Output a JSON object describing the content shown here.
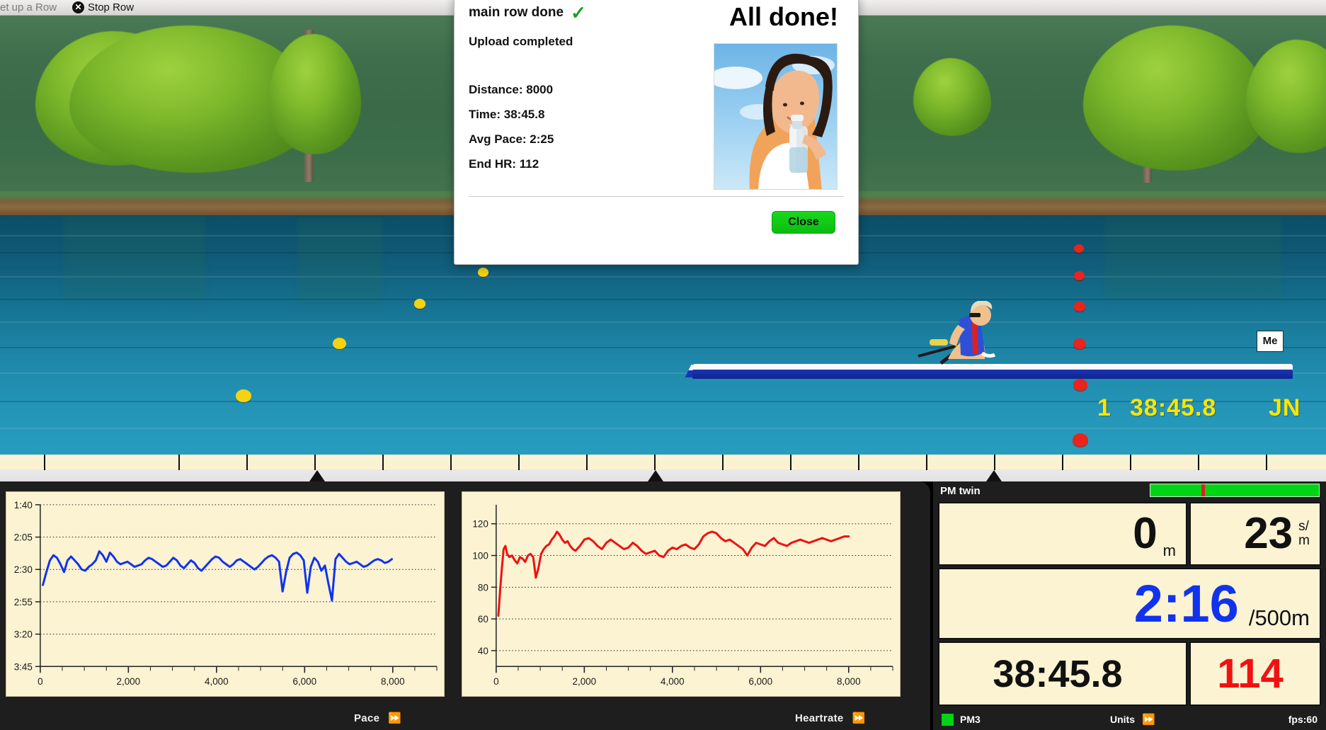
{
  "toolbar": {
    "setup_label": "et up a Row",
    "stop_label": "Stop Row",
    "stop_icon": "close-circle-icon"
  },
  "scene": {
    "boat_flag_label": "Me",
    "race_position": "1",
    "race_time": "38:45.8",
    "race_name": "JN"
  },
  "modal": {
    "heading": "main row done",
    "check_icon": "green-check-icon",
    "subheading": "Upload completed",
    "title": "All done!",
    "stats": [
      "Distance: 8000",
      "Time: 38:45.8",
      "Avg Pace: 2:25",
      "End HR: 112"
    ],
    "close_label": "Close",
    "photo_alt": "woman-drinking-water-photo"
  },
  "pm": {
    "title": "PM twin",
    "bar_color": "#00d415",
    "bar_marker_color": "#e02020",
    "distance_value": "0",
    "distance_unit": "m",
    "rate_value": "23",
    "rate_unit_top": "s/",
    "rate_unit_bottom": "m",
    "pace_value": "2:16",
    "pace_unit": "/500m",
    "pace_color": "#1133ee",
    "time_value": "38:45.8",
    "hr_value": "114",
    "hr_color": "#f21111",
    "status_device": "PM3",
    "status_device_dot": "#00d415",
    "status_units": "Units",
    "status_units_icon": "fast-forward-icon",
    "status_fps": "fps:60"
  },
  "charts_footer": {
    "pace_label": "Pace",
    "pace_icon": "fast-forward-icon",
    "hr_label": "Heartrate",
    "hr_icon": "fast-forward-icon"
  },
  "chart_data": [
    {
      "type": "line",
      "title": "Pace",
      "xlabel": "",
      "ylabel": "",
      "line_color": "#1133ee",
      "grid": true,
      "legend": "none",
      "xlim": [
        0,
        9000
      ],
      "xticks": [
        0,
        2000,
        4000,
        6000,
        8000
      ],
      "xtick_labels": [
        "0",
        "2,000",
        "4,000",
        "6,000",
        "8,000"
      ],
      "yticks": [
        "1:40",
        "2:05",
        "2:30",
        "2:55",
        "3:20",
        "3:45"
      ],
      "ytick_seconds": [
        100,
        125,
        150,
        175,
        200,
        225
      ],
      "y_inverted": true,
      "x": [
        60,
        140,
        220,
        300,
        380,
        460,
        540,
        620,
        700,
        780,
        860,
        940,
        1020,
        1100,
        1180,
        1260,
        1340,
        1420,
        1500,
        1580,
        1660,
        1740,
        1820,
        1900,
        1980,
        2060,
        2140,
        2220,
        2300,
        2380,
        2460,
        2540,
        2620,
        2700,
        2780,
        2860,
        2940,
        3020,
        3100,
        3180,
        3260,
        3340,
        3420,
        3500,
        3580,
        3660,
        3740,
        3820,
        3900,
        3980,
        4060,
        4140,
        4220,
        4300,
        4380,
        4460,
        4540,
        4620,
        4700,
        4780,
        4860,
        4940,
        5020,
        5100,
        5180,
        5260,
        5340,
        5420,
        5500,
        5580,
        5660,
        5740,
        5820,
        5900,
        5980,
        6060,
        6140,
        6220,
        6300,
        6380,
        6460,
        6540,
        6620,
        6700,
        6780,
        6860,
        6940,
        7020,
        7100,
        7180,
        7260,
        7340,
        7420,
        7500,
        7580,
        7660,
        7740,
        7820,
        7900,
        7980
      ],
      "y_seconds": [
        162,
        152,
        143,
        139,
        141,
        146,
        152,
        143,
        140,
        143,
        146,
        150,
        151,
        148,
        146,
        143,
        136,
        139,
        144,
        137,
        140,
        144,
        146,
        145,
        144,
        146,
        148,
        147,
        146,
        143,
        141,
        142,
        144,
        146,
        148,
        147,
        144,
        141,
        143,
        147,
        149,
        146,
        143,
        145,
        149,
        151,
        148,
        145,
        142,
        140,
        141,
        144,
        146,
        148,
        146,
        143,
        142,
        144,
        146,
        148,
        150,
        148,
        145,
        142,
        140,
        139,
        141,
        144,
        167,
        152,
        141,
        138,
        137,
        139,
        143,
        168,
        148,
        141,
        144,
        151,
        147,
        161,
        174,
        142,
        138,
        141,
        144,
        146,
        145,
        144,
        146,
        148,
        147,
        145,
        143,
        142,
        143,
        145,
        144,
        142
      ]
    },
    {
      "type": "line",
      "title": "Heartrate",
      "xlabel": "",
      "ylabel": "",
      "line_color": "#ee1111",
      "grid": true,
      "legend": "none",
      "xlim": [
        0,
        9000
      ],
      "xticks": [
        0,
        2000,
        4000,
        6000,
        8000
      ],
      "xtick_labels": [
        "0",
        "2,000",
        "4,000",
        "6,000",
        "8,000"
      ],
      "yticks": [
        40,
        60,
        80,
        100,
        120
      ],
      "ylim": [
        30,
        132
      ],
      "x": [
        50,
        90,
        130,
        170,
        210,
        250,
        300,
        360,
        420,
        480,
        540,
        600,
        660,
        720,
        780,
        840,
        900,
        960,
        1020,
        1080,
        1140,
        1200,
        1260,
        1320,
        1380,
        1440,
        1500,
        1560,
        1620,
        1680,
        1740,
        1800,
        1900,
        2000,
        2100,
        2200,
        2300,
        2400,
        2500,
        2600,
        2700,
        2800,
        2900,
        3000,
        3100,
        3200,
        3300,
        3400,
        3500,
        3600,
        3700,
        3800,
        3900,
        4000,
        4100,
        4200,
        4300,
        4400,
        4500,
        4600,
        4700,
        4800,
        4900,
        5000,
        5100,
        5200,
        5300,
        5400,
        5500,
        5600,
        5700,
        5800,
        5900,
        6000,
        6100,
        6200,
        6300,
        6400,
        6500,
        6600,
        6700,
        6800,
        6900,
        7000,
        7100,
        7200,
        7300,
        7400,
        7500,
        7600,
        7700,
        7800,
        7900,
        8000
      ],
      "y": [
        62,
        78,
        92,
        104,
        106,
        101,
        99,
        100,
        97,
        95,
        99,
        98,
        96,
        100,
        101,
        99,
        86,
        92,
        101,
        104,
        106,
        107,
        110,
        112,
        115,
        113,
        110,
        108,
        109,
        106,
        104,
        103,
        106,
        110,
        111,
        109,
        106,
        104,
        108,
        110,
        108,
        106,
        104,
        105,
        108,
        106,
        103,
        101,
        102,
        103,
        100,
        99,
        103,
        105,
        104,
        106,
        107,
        105,
        104,
        107,
        112,
        114,
        115,
        114,
        111,
        109,
        110,
        108,
        106,
        104,
        100,
        105,
        108,
        107,
        106,
        109,
        111,
        108,
        107,
        106,
        108,
        109,
        110,
        109,
        108,
        109,
        110,
        111,
        110,
        109,
        110,
        111,
        112,
        112
      ]
    }
  ]
}
